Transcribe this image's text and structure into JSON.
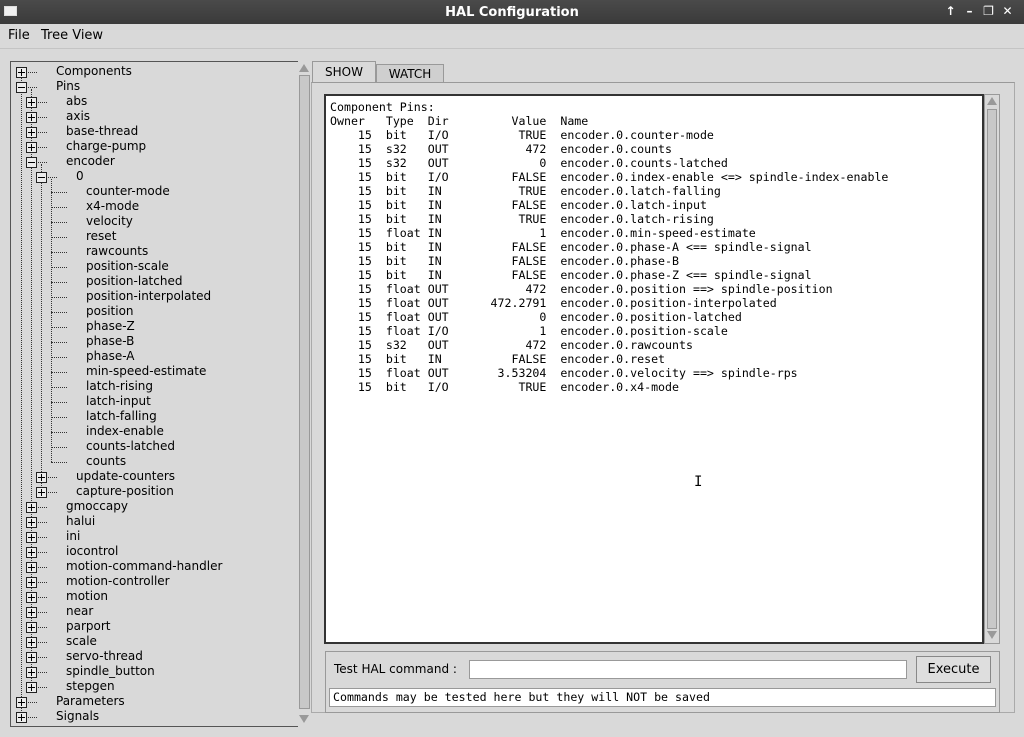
{
  "window": {
    "title": "HAL Configuration"
  },
  "titlebar_buttons": [
    "↑",
    "–",
    "❐",
    "✕"
  ],
  "menu": {
    "file": "File",
    "tree_view": "Tree View"
  },
  "tabs": {
    "show": "SHOW",
    "watch": "WATCH"
  },
  "tree": [
    {
      "label": "Components",
      "level": 0,
      "exp": "plus"
    },
    {
      "label": "Pins",
      "level": 0,
      "exp": "minus"
    },
    {
      "label": "abs",
      "level": 1,
      "exp": "plus"
    },
    {
      "label": "axis",
      "level": 1,
      "exp": "plus"
    },
    {
      "label": "base-thread",
      "level": 1,
      "exp": "plus"
    },
    {
      "label": "charge-pump",
      "level": 1,
      "exp": "plus"
    },
    {
      "label": "encoder",
      "level": 1,
      "exp": "minus"
    },
    {
      "label": "0",
      "level": 2,
      "exp": "minus"
    },
    {
      "label": "counter-mode",
      "level": 3,
      "exp": "none"
    },
    {
      "label": "x4-mode",
      "level": 3,
      "exp": "none"
    },
    {
      "label": "velocity",
      "level": 3,
      "exp": "none"
    },
    {
      "label": "reset",
      "level": 3,
      "exp": "none"
    },
    {
      "label": "rawcounts",
      "level": 3,
      "exp": "none"
    },
    {
      "label": "position-scale",
      "level": 3,
      "exp": "none"
    },
    {
      "label": "position-latched",
      "level": 3,
      "exp": "none"
    },
    {
      "label": "position-interpolated",
      "level": 3,
      "exp": "none"
    },
    {
      "label": "position",
      "level": 3,
      "exp": "none"
    },
    {
      "label": "phase-Z",
      "level": 3,
      "exp": "none"
    },
    {
      "label": "phase-B",
      "level": 3,
      "exp": "none"
    },
    {
      "label": "phase-A",
      "level": 3,
      "exp": "none"
    },
    {
      "label": "min-speed-estimate",
      "level": 3,
      "exp": "none"
    },
    {
      "label": "latch-rising",
      "level": 3,
      "exp": "none"
    },
    {
      "label": "latch-input",
      "level": 3,
      "exp": "none"
    },
    {
      "label": "latch-falling",
      "level": 3,
      "exp": "none"
    },
    {
      "label": "index-enable",
      "level": 3,
      "exp": "none"
    },
    {
      "label": "counts-latched",
      "level": 3,
      "exp": "none"
    },
    {
      "label": "counts",
      "level": 3,
      "exp": "none"
    },
    {
      "label": "update-counters",
      "level": 2,
      "exp": "plus"
    },
    {
      "label": "capture-position",
      "level": 2,
      "exp": "plus"
    },
    {
      "label": "gmoccapy",
      "level": 1,
      "exp": "plus"
    },
    {
      "label": "halui",
      "level": 1,
      "exp": "plus"
    },
    {
      "label": "ini",
      "level": 1,
      "exp": "plus"
    },
    {
      "label": "iocontrol",
      "level": 1,
      "exp": "plus"
    },
    {
      "label": "motion-command-handler",
      "level": 1,
      "exp": "plus"
    },
    {
      "label": "motion-controller",
      "level": 1,
      "exp": "plus"
    },
    {
      "label": "motion",
      "level": 1,
      "exp": "plus"
    },
    {
      "label": "near",
      "level": 1,
      "exp": "plus"
    },
    {
      "label": "parport",
      "level": 1,
      "exp": "plus"
    },
    {
      "label": "scale",
      "level": 1,
      "exp": "plus"
    },
    {
      "label": "servo-thread",
      "level": 1,
      "exp": "plus"
    },
    {
      "label": "spindle_button",
      "level": 1,
      "exp": "plus"
    },
    {
      "label": "stepgen",
      "level": 1,
      "exp": "plus"
    },
    {
      "label": "Parameters",
      "level": 0,
      "exp": "plus"
    },
    {
      "label": "Signals",
      "level": 0,
      "exp": "plus"
    }
  ],
  "show": {
    "heading": "Component Pins:",
    "columns": [
      "Owner",
      "Type",
      "Dir",
      "Value",
      "Name"
    ],
    "rows": [
      [
        "15",
        "bit",
        "I/O",
        "TRUE",
        "encoder.0.counter-mode"
      ],
      [
        "15",
        "s32",
        "OUT",
        "472",
        "encoder.0.counts"
      ],
      [
        "15",
        "s32",
        "OUT",
        "0",
        "encoder.0.counts-latched"
      ],
      [
        "15",
        "bit",
        "I/O",
        "FALSE",
        "encoder.0.index-enable <=> spindle-index-enable"
      ],
      [
        "15",
        "bit",
        "IN",
        "TRUE",
        "encoder.0.latch-falling"
      ],
      [
        "15",
        "bit",
        "IN",
        "FALSE",
        "encoder.0.latch-input"
      ],
      [
        "15",
        "bit",
        "IN",
        "TRUE",
        "encoder.0.latch-rising"
      ],
      [
        "15",
        "float",
        "IN",
        "1",
        "encoder.0.min-speed-estimate"
      ],
      [
        "15",
        "bit",
        "IN",
        "FALSE",
        "encoder.0.phase-A <== spindle-signal"
      ],
      [
        "15",
        "bit",
        "IN",
        "FALSE",
        "encoder.0.phase-B"
      ],
      [
        "15",
        "bit",
        "IN",
        "FALSE",
        "encoder.0.phase-Z <== spindle-signal"
      ],
      [
        "15",
        "float",
        "OUT",
        "472",
        "encoder.0.position ==> spindle-position"
      ],
      [
        "15",
        "float",
        "OUT",
        "472.2791",
        "encoder.0.position-interpolated"
      ],
      [
        "15",
        "float",
        "OUT",
        "0",
        "encoder.0.position-latched"
      ],
      [
        "15",
        "float",
        "I/O",
        "1",
        "encoder.0.position-scale"
      ],
      [
        "15",
        "s32",
        "OUT",
        "472",
        "encoder.0.rawcounts"
      ],
      [
        "15",
        "bit",
        "IN",
        "FALSE",
        "encoder.0.reset"
      ],
      [
        "15",
        "float",
        "OUT",
        "3.53204",
        "encoder.0.velocity ==> spindle-rps"
      ],
      [
        "15",
        "bit",
        "I/O",
        "TRUE",
        "encoder.0.x4-mode"
      ]
    ]
  },
  "command": {
    "label": "Test HAL command :",
    "input_value": "",
    "execute_label": "Execute",
    "status": "Commands may be tested here but they will NOT be saved"
  }
}
